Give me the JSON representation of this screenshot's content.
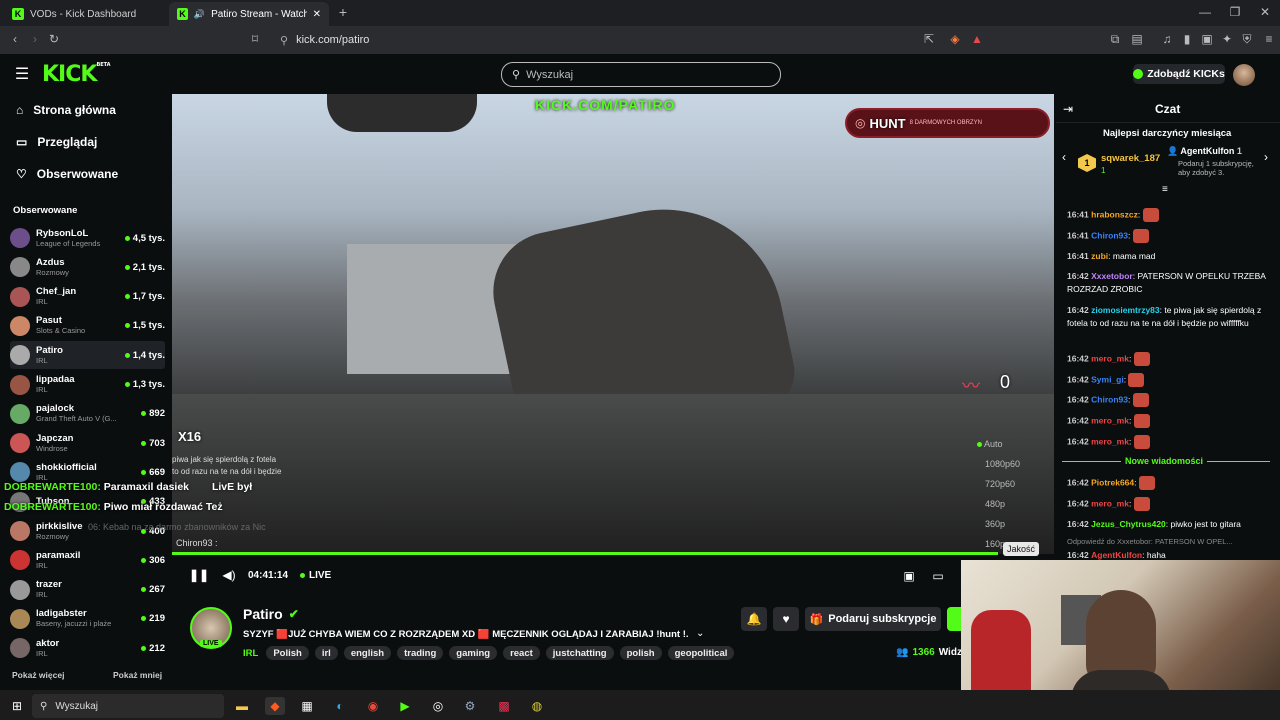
{
  "browser": {
    "tabs": [
      {
        "label": "VODs - Kick Dashboard"
      },
      {
        "label": "Patiro Stream - Watch Live on"
      }
    ],
    "url": "kick.com/patiro"
  },
  "header": {
    "logo": "KICK",
    "beta": "BETA",
    "search_placeholder": "Wyszukaj",
    "get_kicks": "Zdobądź KICKs"
  },
  "nav": [
    {
      "label": "Strona główna",
      "icon": "home-icon"
    },
    {
      "label": "Przeglądaj",
      "icon": "browse-icon"
    },
    {
      "label": "Obserwowane",
      "icon": "heart-icon"
    }
  ],
  "followed": {
    "title": "Obserwowane",
    "items": [
      {
        "name": "RybsonLoL",
        "cat": "League of Legends",
        "viewers": "4,5 tys."
      },
      {
        "name": "Azdus",
        "cat": "Rozmowy",
        "viewers": "2,1 tys."
      },
      {
        "name": "Chef_jan",
        "cat": "IRL",
        "viewers": "1,7 tys."
      },
      {
        "name": "Pasut",
        "cat": "Slots & Casino",
        "viewers": "1,5 tys."
      },
      {
        "name": "Patiro",
        "cat": "IRL",
        "viewers": "1,4 tys."
      },
      {
        "name": "lippadaa",
        "cat": "IRL",
        "viewers": "1,3 tys."
      },
      {
        "name": "pajalock",
        "cat": "Grand Theft Auto V (G...",
        "viewers": "892"
      },
      {
        "name": "Japczan",
        "cat": "Windrose",
        "viewers": "703"
      },
      {
        "name": "shokkiofficial",
        "cat": "IRL",
        "viewers": "669"
      },
      {
        "name": "Tubson",
        "cat": "",
        "viewers": "433"
      },
      {
        "name": "pirkkislive",
        "cat": "Rozmowy",
        "viewers": "400"
      },
      {
        "name": "paramaxil",
        "cat": "IRL",
        "viewers": "306"
      },
      {
        "name": "trazer",
        "cat": "IRL",
        "viewers": "267"
      },
      {
        "name": "ladigabster",
        "cat": "Baseny, jacuzzi i plaże",
        "viewers": "219"
      },
      {
        "name": "aktor",
        "cat": "IRL",
        "viewers": "212"
      }
    ],
    "show_more": "Pokaż więcej",
    "show_less": "Pokaż mniej"
  },
  "video": {
    "watermark": "KICK.COM/PATIRO",
    "hunt": "HUNT",
    "hunt_sub": "8 DARMOWYCH OBRZYN",
    "counter": "0",
    "x16": "X16",
    "time": "04:41:14",
    "live": "LIVE",
    "quality_label": "Jakość",
    "qualities": [
      "Auto",
      "1080p60",
      "720p60",
      "480p",
      "360p",
      "160p"
    ],
    "overlay": [
      {
        "user": "DOBREWARTE100:",
        "text": "Paramaxil dasiek"
      },
      {
        "user": "DOBREWARTE100:",
        "text": "Piwo miał rozdawać Też"
      }
    ],
    "ghost_chat": [
      "piwa jak się spierdolą z fotela",
      "to od razu na te na dół i będzie",
      "Chiron93 :"
    ],
    "ghost_line": "06: Kebab na za darmo zbanowników za Nic",
    "ghost_live": "LivE był"
  },
  "stream": {
    "name": "Patiro",
    "title": "SYZYF 🟥JUŻ CHYBA WIEM CO Z ROZRZĄDEM XD 🟥 MĘCZENNIK OGLĄDAJ I ZARABIAJ !hunt !...",
    "category": "IRL",
    "tags": [
      "Polish",
      "irl",
      "english",
      "trading",
      "gaming",
      "react",
      "justchatting",
      "polish",
      "geopolitical"
    ],
    "subscribe": "Podaruj subskrypcje",
    "viewers": "1366",
    "viewers_label": "Widzó",
    "live_badge": "LIVE"
  },
  "chat": {
    "title": "Czat",
    "top_title": "Najlepsi darczyńcy miesiąca",
    "top1": "sqwarek_187",
    "top1_count": "1",
    "top2": "AgentKulfon",
    "top2_count": "1",
    "top2_sub": "Podaruj 1 subskrypcję, aby zdobyć 3.",
    "rank": "1",
    "new_messages": "Nowe wiadomości",
    "messages": [
      {
        "time": "16:41",
        "user": "hrabonszcz",
        "color": "#f5a623",
        "text": "",
        "emote": true
      },
      {
        "time": "16:41",
        "user": "Chiron93",
        "color": "#3b82f6",
        "text": "",
        "emote": true
      },
      {
        "time": "16:41",
        "user": "zubi",
        "color": "#f5a623",
        "text": "mama mad",
        "emote": false
      },
      {
        "time": "16:42",
        "user": "Xxxetobor",
        "color": "#c084fc",
        "text": "PATERSON W OPELKU TRZEBA ROZRZAD ZROBIC",
        "emote": false
      },
      {
        "time": "16:42",
        "user": "ziomosiemtrzy83",
        "color": "#22d3ee",
        "text": "te piwa jak się spierdolą z fotela to od razu na te na dół i będzie po wifffffku",
        "emote": false
      },
      {
        "time": "16:42",
        "user": "mero_mk",
        "color": "#ef4444",
        "text": "",
        "emote": true
      },
      {
        "time": "16:42",
        "user": "Symi_gi",
        "color": "#3b82f6",
        "text": "",
        "emote": true
      },
      {
        "time": "16:42",
        "user": "Chiron93",
        "color": "#3b82f6",
        "text": "",
        "emote": true
      },
      {
        "time": "16:42",
        "user": "mero_mk",
        "color": "#ef4444",
        "text": "",
        "emote": true
      },
      {
        "time": "16:42",
        "user": "mero_mk",
        "color": "#ef4444",
        "text": "",
        "emote": true
      }
    ],
    "messages2": [
      {
        "time": "16:42",
        "user": "Piotrek664",
        "color": "#f5a623",
        "text": "",
        "emote": true
      },
      {
        "time": "16:42",
        "user": "mero_mk",
        "color": "#ef4444",
        "text": "",
        "emote": true
      },
      {
        "time": "16:42",
        "user": "Jezus_Chytrus420",
        "color": "#53fc18",
        "text": "piwko jest to gitara",
        "emote": false
      }
    ],
    "reply": "Odpowiedź do Xxxetobor: PATERSON W OPEL...",
    "last_time": "16:42",
    "last_user": "AgentKulfon",
    "last_text": "haha"
  },
  "taskbar": {
    "search": "Wyszukaj"
  },
  "colors": {
    "accent": "#53fc18"
  }
}
